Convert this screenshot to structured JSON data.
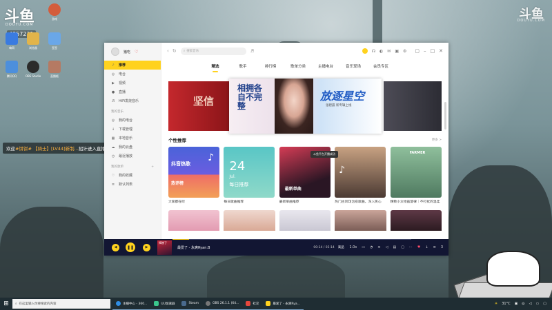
{
  "watermark": {
    "logo_left": "斗鱼",
    "logo_left_sub": "DOUYU.COM",
    "logo_right": "斗鱼",
    "logo_right_sub": "DOUYU.COM",
    "fans": "4357231"
  },
  "desktop_icons": [
    {
      "label": "嗨网"
    },
    {
      "label": "浏览器"
    },
    {
      "label": "游戏"
    },
    {
      "label": "歪歪"
    },
    {
      "label": "腾讯QQ"
    },
    {
      "label": "OBS Studio"
    },
    {
      "label": "直播姬"
    }
  ],
  "chat": {
    "prefix": "欢迎",
    "user": "#饼饼# 【骑士】[LV44]新制...",
    "suffix": "招计进入直播间"
  },
  "app": {
    "user_name": "猪吃",
    "search_placeholder": "搜索音乐",
    "sidebar": {
      "items": [
        {
          "label": "推荐",
          "glyph": "♪"
        },
        {
          "label": "电台",
          "glyph": "◎"
        },
        {
          "label": "视频",
          "glyph": "▶"
        },
        {
          "label": "直播",
          "glyph": "●"
        },
        {
          "label": "HiFi发烧音乐",
          "glyph": "♬"
        }
      ],
      "my_music_title": "我的音乐",
      "my_items": [
        {
          "label": "我的电台",
          "glyph": "◎"
        },
        {
          "label": "下载管理",
          "glyph": "↓"
        },
        {
          "label": "本地音乐",
          "glyph": "▦"
        },
        {
          "label": "我的云盘",
          "glyph": "☁"
        },
        {
          "label": "最近播放",
          "glyph": "◷"
        }
      ],
      "playlist_title": "我的歌单",
      "playlist_items": [
        {
          "label": "我的收藏",
          "glyph": "♡"
        },
        {
          "label": "默认列表",
          "glyph": "≡"
        }
      ]
    },
    "tabs": [
      "精选",
      "歌手",
      "排行榜",
      "歌单分类",
      "主播电台",
      "音乐现场",
      "会员专区"
    ],
    "banner": {
      "left_text": "坚信",
      "lyric": "相拥各自不完整",
      "title": "放逐星空",
      "sub": "张碧晨  新专辑上线"
    },
    "section_title": "个性推荐",
    "section_more": "更多 >",
    "cards": [
      {
        "badge": "抖音热歌",
        "sub": "热评榜",
        "caption": "大家都在听"
      },
      {
        "day": "24",
        "month": "Jul.",
        "label": "每日推荐",
        "caption": "每日歌曲推荐"
      },
      {
        "badge": "最新单曲",
        "caption": "最新单曲推荐"
      },
      {
        "caption": "热门古风DJ治愈歌曲，深入民心"
      },
      {
        "badge": "FARMER",
        "caption": "精致小众绘画旋律｜不打扰的温柔"
      }
    ],
    "tooltip": "斗鱼平台开播成功",
    "player": {
      "cover_text": "揭晓了",
      "track": "最爱了 - 永爽Ryan.B",
      "time": "00:14 / 03:14",
      "quality": "高品",
      "speed": "1.0x",
      "count": "3",
      "progress": 0.07
    }
  },
  "taskbar": {
    "search_placeholder": "在这里输入你要搜索的内容",
    "apps": [
      {
        "label": "主播中心 - 360...",
        "color": "#2f8de4"
      },
      {
        "label": "UU加速器",
        "color": "#3bc78d"
      },
      {
        "label": "Steam",
        "color": "#1b2838"
      },
      {
        "label": "OBS 26.1.1 (64...",
        "color": "#444"
      },
      {
        "label": "社交",
        "color": "#e7473c"
      },
      {
        "label": "最爱了 - 永爽Rya...",
        "color": "#ffd21e"
      }
    ],
    "weather": "31°C"
  }
}
